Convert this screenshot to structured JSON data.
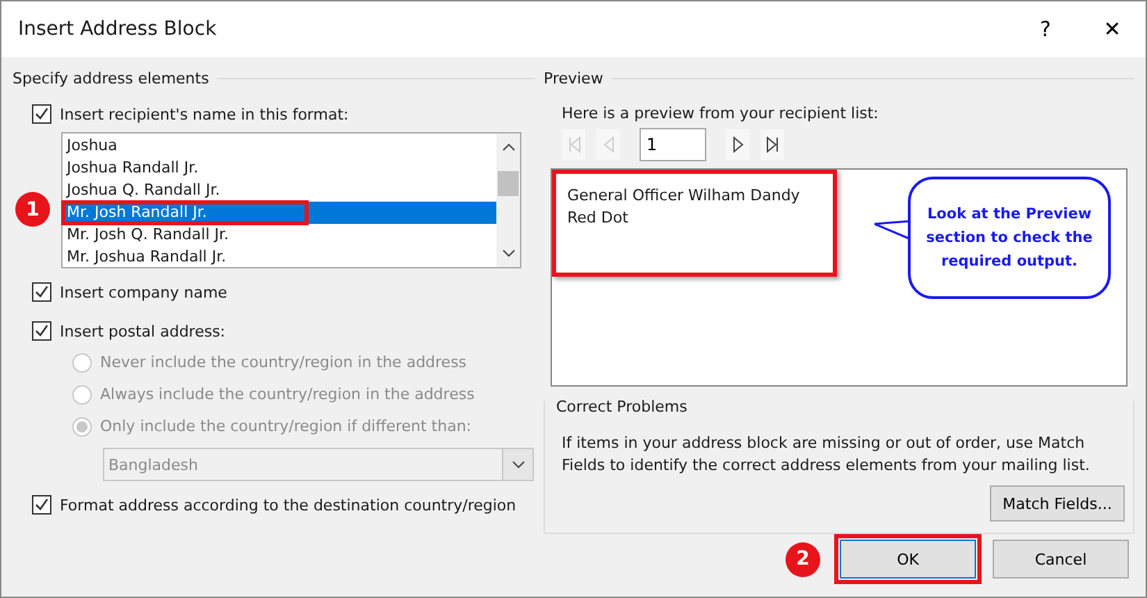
{
  "window": {
    "title": "Insert Address Block",
    "help": "?",
    "close": "✕"
  },
  "address_elements": {
    "title": "Specify address elements",
    "name_option": {
      "label": "Insert recipient's name in this format:",
      "checked": true
    },
    "name_formats": [
      {
        "label": "Joshua",
        "selected": false,
        "annotated": false
      },
      {
        "label": "Joshua Randall Jr.",
        "selected": false,
        "annotated": false
      },
      {
        "label": "Joshua Q. Randall Jr.",
        "selected": false,
        "annotated": false
      },
      {
        "label": "Mr. Josh Randall Jr.",
        "selected": true,
        "annotated": true
      },
      {
        "label": "Mr. Josh Q. Randall Jr.",
        "selected": false,
        "annotated": false
      },
      {
        "label": "Mr. Joshua Randall Jr.",
        "selected": false,
        "annotated": false
      }
    ],
    "company_option": {
      "label": "Insert company name",
      "checked": true
    },
    "postal_option": {
      "label": "Insert postal address:",
      "checked": true
    },
    "country_options": [
      {
        "label": "Never include the country/region in the address",
        "selected": false,
        "disabled": true
      },
      {
        "label": "Always include the country/region in the address",
        "selected": false,
        "disabled": true
      },
      {
        "label": "Only include the country/region if different than:",
        "selected": true,
        "disabled": true
      }
    ],
    "country": {
      "value": "Bangladesh",
      "disabled": true
    },
    "format_option": {
      "label": "Format address according to the destination country/region",
      "checked": true
    }
  },
  "preview": {
    "title": "Preview",
    "caption": "Here is a preview from your recipient list:",
    "record": "1",
    "address_lines": [
      "General Officer Wilham Dandy",
      "Red Dot"
    ]
  },
  "correct_problems": {
    "title": "Correct Problems",
    "text": "If items in your address block are missing or out of order, use Match Fields to identify the correct address elements from your mailing list.",
    "button": "Match Fields..."
  },
  "buttons": [
    {
      "label": "OK",
      "default": true,
      "annotated": true
    },
    {
      "label": "Cancel",
      "default": false,
      "annotated": false
    }
  ],
  "annotations": {
    "callout": "Look at the Preview section to check the required output.",
    "markers": [
      "1",
      "2"
    ]
  }
}
